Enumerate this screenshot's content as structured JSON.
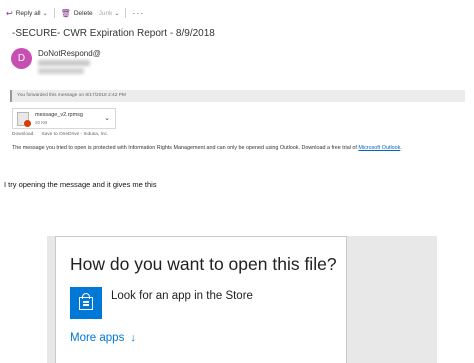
{
  "toolbar": {
    "reply_all": "Reply all",
    "delete": "Delete",
    "junk": "Junk",
    "more": "···"
  },
  "email": {
    "subject": "-SECURE- CWR Expiration Report - 8/9/2018",
    "avatar_letter": "D",
    "sender": "DoNotRespond@",
    "forwarded_notice": "You forwarded this message on 8/17/2018 2:42 PM",
    "attachment": {
      "name": "message_v2.rpmsg",
      "size": "20 KB",
      "download": "Download",
      "save": "Save to OneDrive - Indusa, Inc."
    },
    "irm_message": "The message you tried to open is protected with Information Rights Management and can only be opened using Outlook. Download a free trial of ",
    "irm_link": "Microsoft Outlook",
    "irm_period": "."
  },
  "comment": "I try opening the message and it gives me this",
  "dialog": {
    "title": "How do you want to open this file?",
    "store_option": "Look for an app in the Store",
    "more_apps": "More apps",
    "more_arrow": "↓"
  },
  "colors": {
    "accent": "#7a2f8d",
    "avatar": "#c94eb1",
    "link": "#0563c1",
    "store_blue": "#0078d7"
  }
}
